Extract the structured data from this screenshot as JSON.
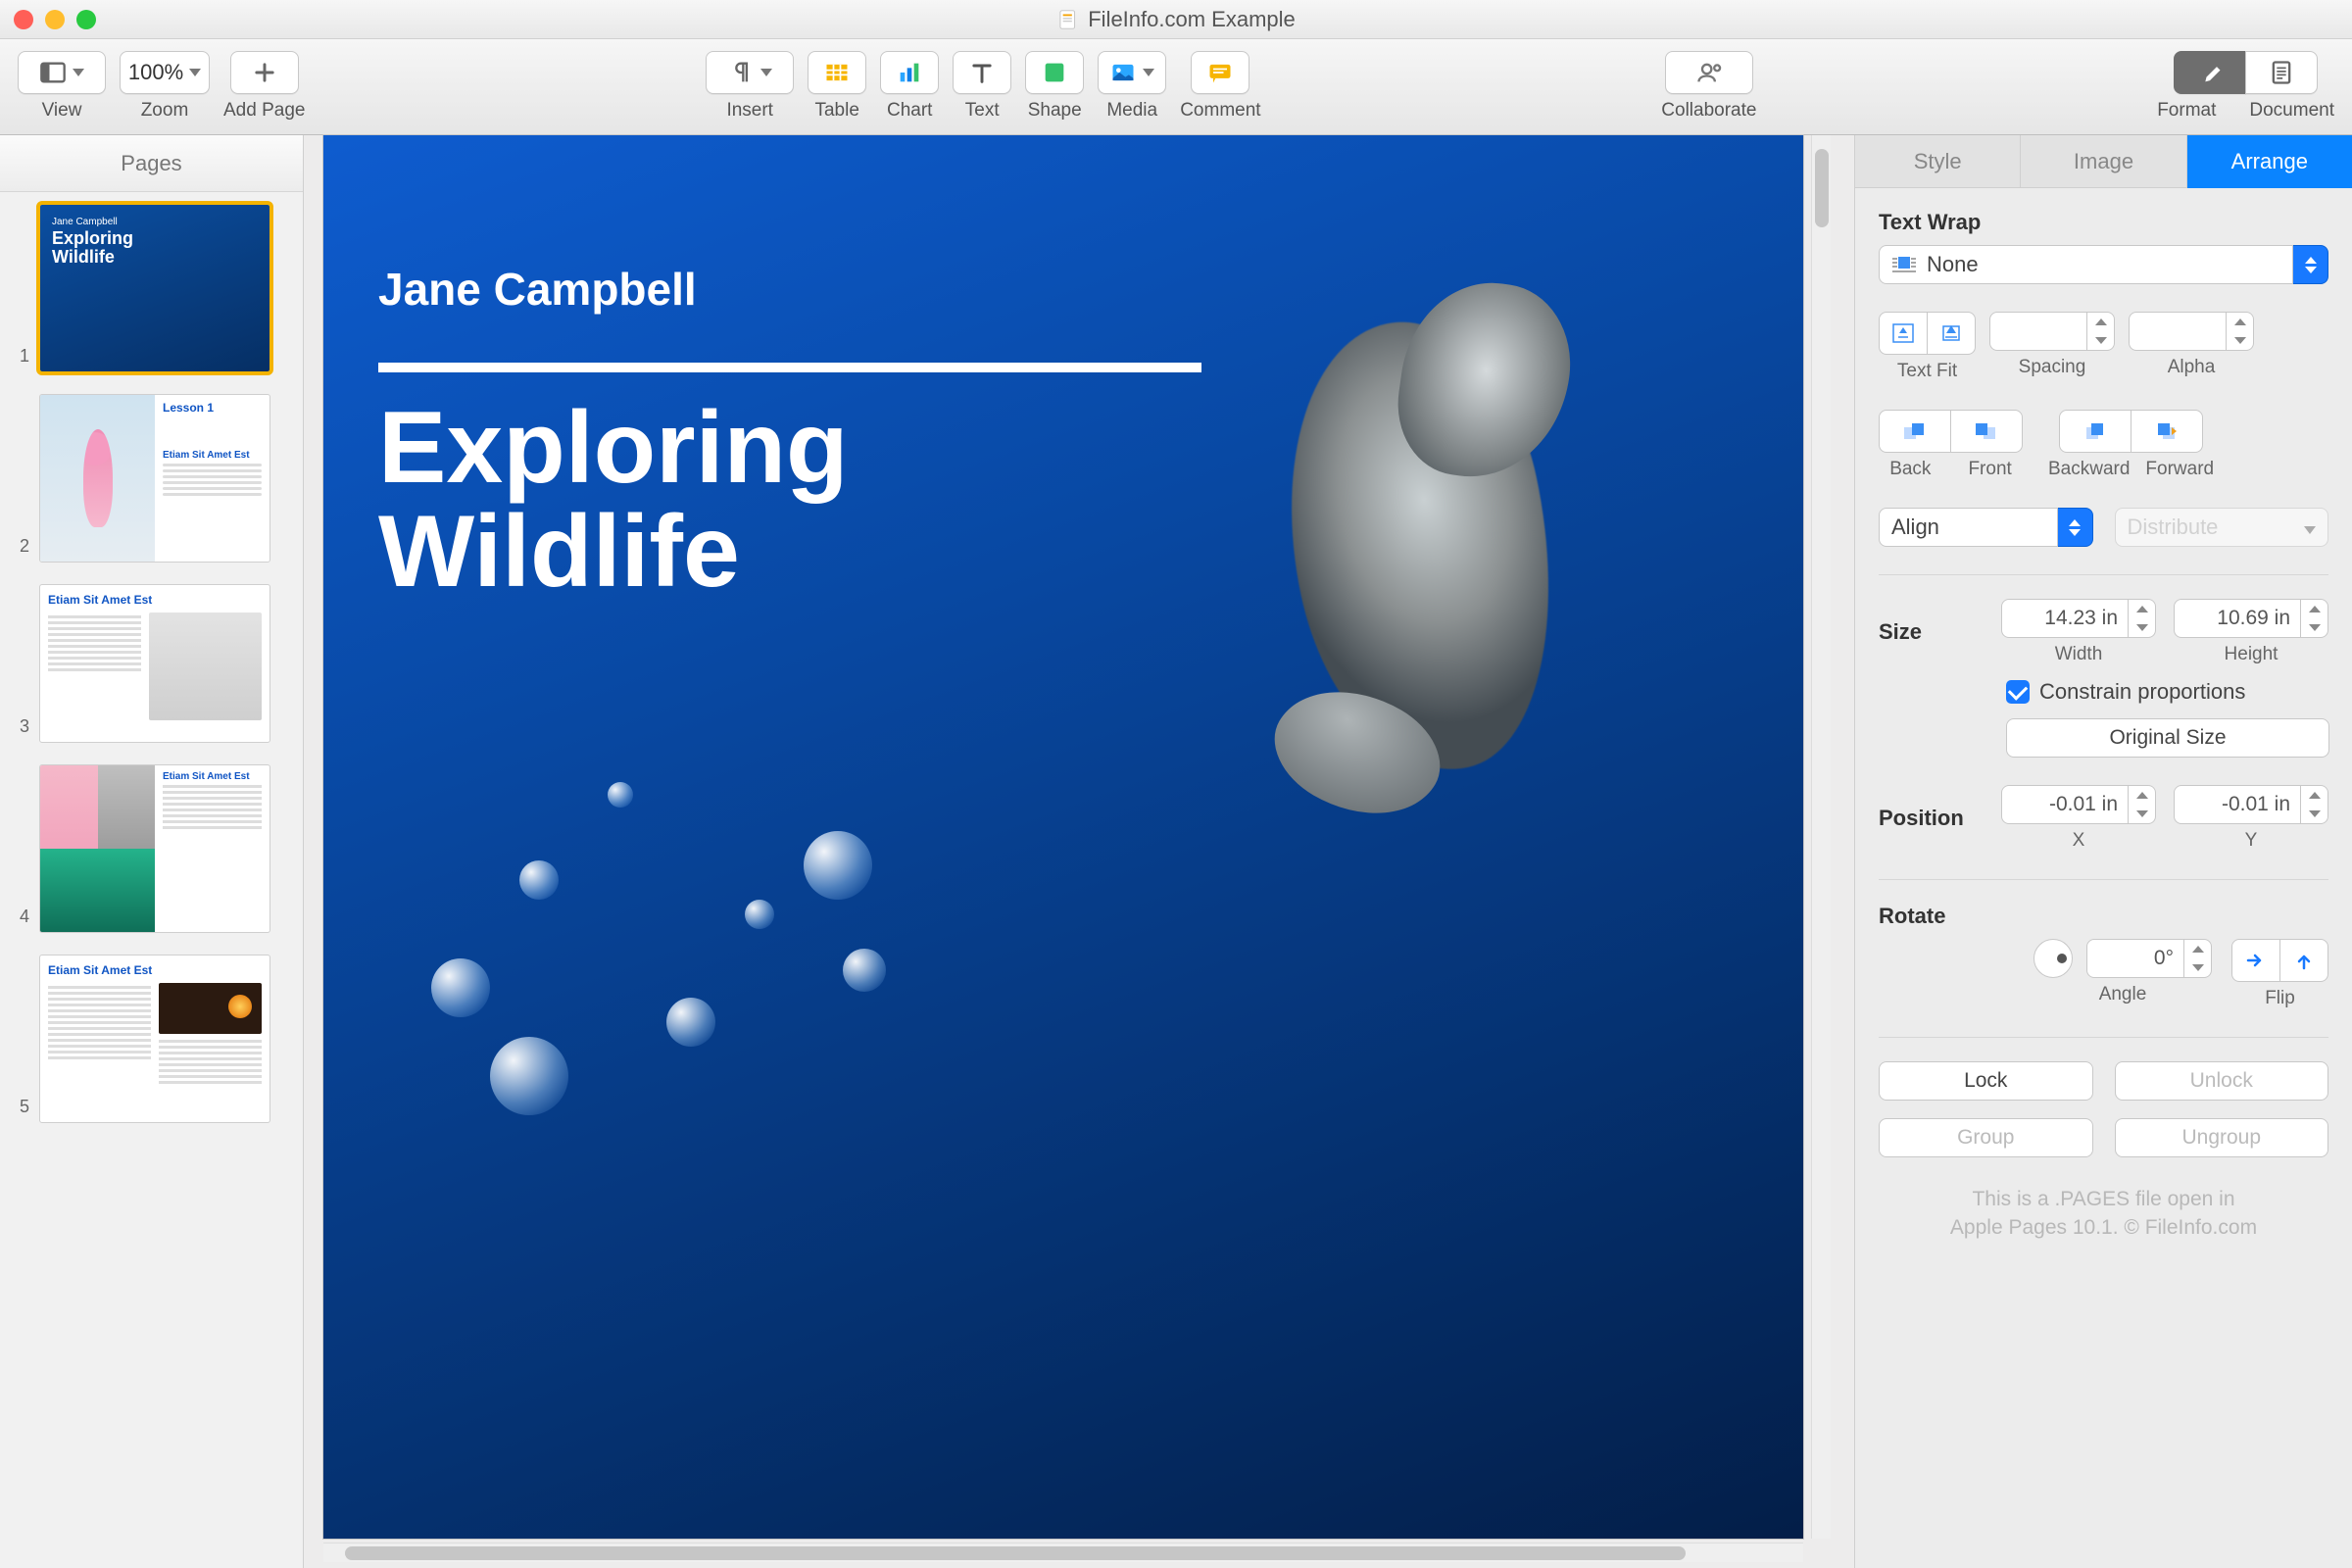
{
  "window": {
    "title": "FileInfo.com Example"
  },
  "toolbar": {
    "view": "View",
    "zoom_label": "Zoom",
    "zoom_value": "100%",
    "add_page": "Add Page",
    "insert": "Insert",
    "table": "Table",
    "chart": "Chart",
    "text": "Text",
    "shape": "Shape",
    "media": "Media",
    "comment": "Comment",
    "collaborate": "Collaborate",
    "format": "Format",
    "document": "Document"
  },
  "sidebar": {
    "heading": "Pages",
    "thumbs": [
      {
        "n": "1",
        "subtitle": "Jane Campbell",
        "title": "Exploring\nWildlife"
      },
      {
        "n": "2",
        "hd": "Lesson 1",
        "sub": "Etiam Sit Amet Est"
      },
      {
        "n": "3",
        "hd": "Etiam Sit Amet Est"
      },
      {
        "n": "4",
        "hd": "Etiam Sit Amet Est"
      },
      {
        "n": "5",
        "hd": "Etiam Sit Amet Est"
      }
    ]
  },
  "canvas": {
    "subtitle": "Jane Campbell",
    "title_l1": "Exploring",
    "title_l2": "Wildlife"
  },
  "inspector": {
    "tabs": {
      "style": "Style",
      "image": "Image",
      "arrange": "Arrange"
    },
    "text_wrap": {
      "label": "Text Wrap",
      "value": "None"
    },
    "text_fit": "Text Fit",
    "spacing": "Spacing",
    "alpha": "Alpha",
    "back": "Back",
    "front": "Front",
    "backward": "Backward",
    "forward": "Forward",
    "align": "Align",
    "distribute": "Distribute",
    "size_label": "Size",
    "width": "Width",
    "height": "Height",
    "width_val": "14.23 in",
    "height_val": "10.69 in",
    "constrain": "Constrain proportions",
    "original_size": "Original Size",
    "position_label": "Position",
    "x": "X",
    "y": "Y",
    "x_val": "-0.01 in",
    "y_val": "-0.01 in",
    "rotate_label": "Rotate",
    "angle": "Angle",
    "angle_val": "0°",
    "flip": "Flip",
    "lock": "Lock",
    "unlock": "Unlock",
    "group": "Group",
    "ungroup": "Ungroup",
    "footer_l1": "This is a .PAGES file open in",
    "footer_l2": "Apple Pages 10.1. © FileInfo.com"
  }
}
